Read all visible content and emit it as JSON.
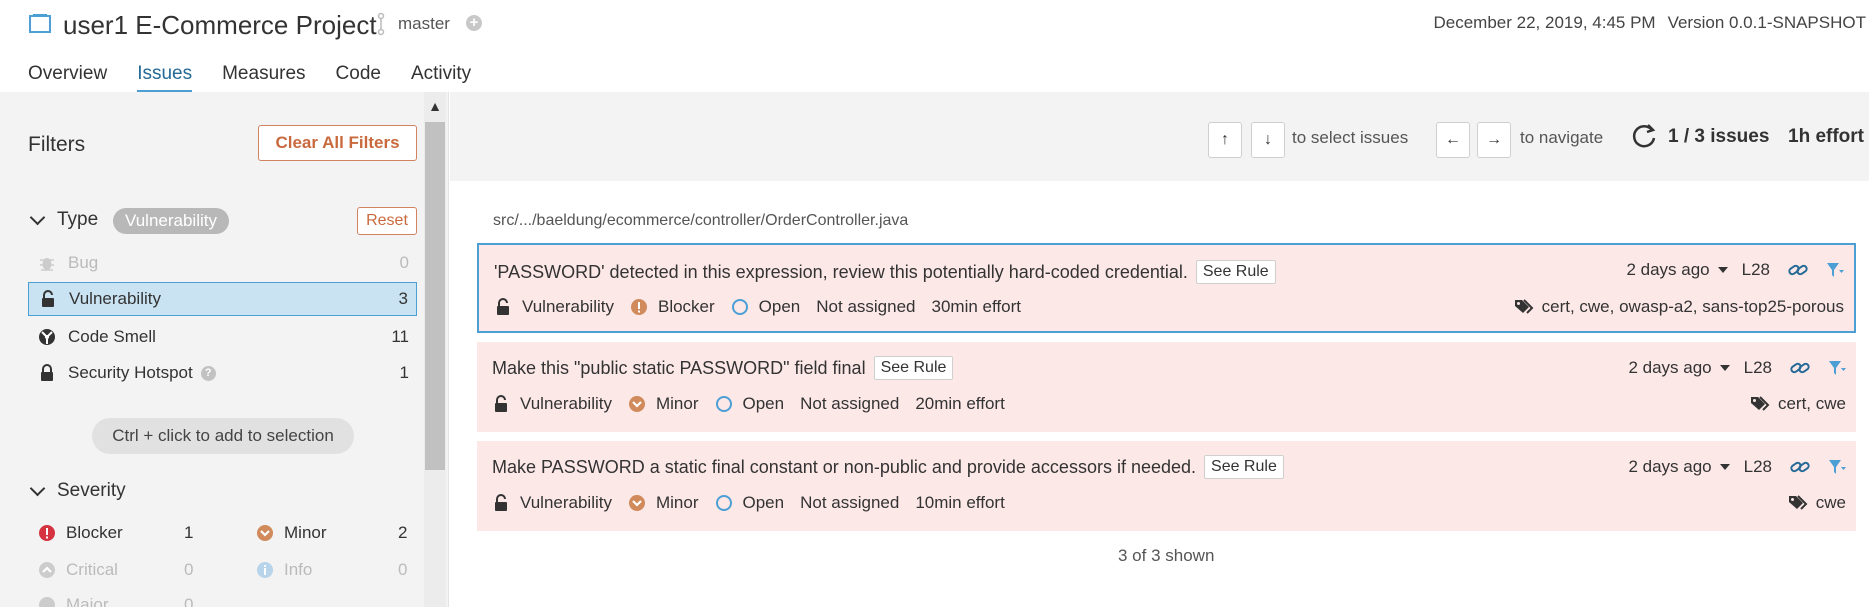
{
  "header": {
    "project_title": "user1 E-Commerce Project",
    "branch": "master",
    "date": "December 22, 2019, 4:45 PM",
    "version": "Version 0.0.1-SNAPSHOT"
  },
  "nav": {
    "tabs": [
      {
        "label": "Overview",
        "active": false
      },
      {
        "label": "Issues",
        "active": true
      },
      {
        "label": "Measures",
        "active": false
      },
      {
        "label": "Code",
        "active": false
      },
      {
        "label": "Activity",
        "active": false
      }
    ]
  },
  "filters": {
    "title": "Filters",
    "clear_all": "Clear All Filters",
    "type": {
      "label": "Type",
      "badge": "Vulnerability",
      "reset": "Reset",
      "items": [
        {
          "label": "Bug",
          "count": "0",
          "icon": "bug-icon"
        },
        {
          "label": "Vulnerability",
          "count": "3",
          "icon": "open-lock-icon"
        },
        {
          "label": "Code Smell",
          "count": "11",
          "icon": "code-smell-icon"
        },
        {
          "label": "Security Hotspot",
          "count": "1",
          "icon": "hotspot-lock-icon"
        }
      ]
    },
    "hint": "Ctrl + click to add to selection",
    "severity": {
      "label": "Severity",
      "items": [
        {
          "label": "Blocker",
          "count": "1"
        },
        {
          "label": "Minor",
          "count": "2"
        },
        {
          "label": "Critical",
          "count": "0"
        },
        {
          "label": "Info",
          "count": "0"
        },
        {
          "label": "Major",
          "count": "0"
        }
      ]
    }
  },
  "toolbar": {
    "up_key": "↑",
    "down_key": "↓",
    "select_text": "to select issues",
    "left_key": "←",
    "right_key": "→",
    "navigate_text": "to navigate",
    "count": "1 / 3 issues",
    "effort": "1h effort"
  },
  "file_path": "src/.../baeldung/ecommerce/controller/OrderController.java",
  "issues": [
    {
      "title": "'PASSWORD' detected in this expression, review this potentially hard-coded credential.",
      "see_rule": "See Rule",
      "type": "Vulnerability",
      "severity": "Blocker",
      "status": "Open",
      "assignee": "Not assigned",
      "effort": "30min effort",
      "ago": "2 days ago",
      "line": "L28",
      "tags": "cert, cwe, owasp-a2, sans-top25-porous"
    },
    {
      "title": "Make this \"public static PASSWORD\" field final",
      "see_rule": "See Rule",
      "type": "Vulnerability",
      "severity": "Minor",
      "status": "Open",
      "assignee": "Not assigned",
      "effort": "20min effort",
      "ago": "2 days ago",
      "line": "L28",
      "tags": "cert, cwe"
    },
    {
      "title": "Make PASSWORD a static final constant or non-public and provide accessors if needed.",
      "see_rule": "See Rule",
      "type": "Vulnerability",
      "severity": "Minor",
      "status": "Open",
      "assignee": "Not assigned",
      "effort": "10min effort",
      "ago": "2 days ago",
      "line": "L28",
      "tags": "cwe"
    }
  ],
  "shown": "3 of 3 shown",
  "colors": {
    "accent": "#4b9fd5",
    "issue_bg": "#fde8e8",
    "blocker": "#d4333f",
    "minor": "#d08a5b",
    "reset_border": "#d18360"
  }
}
